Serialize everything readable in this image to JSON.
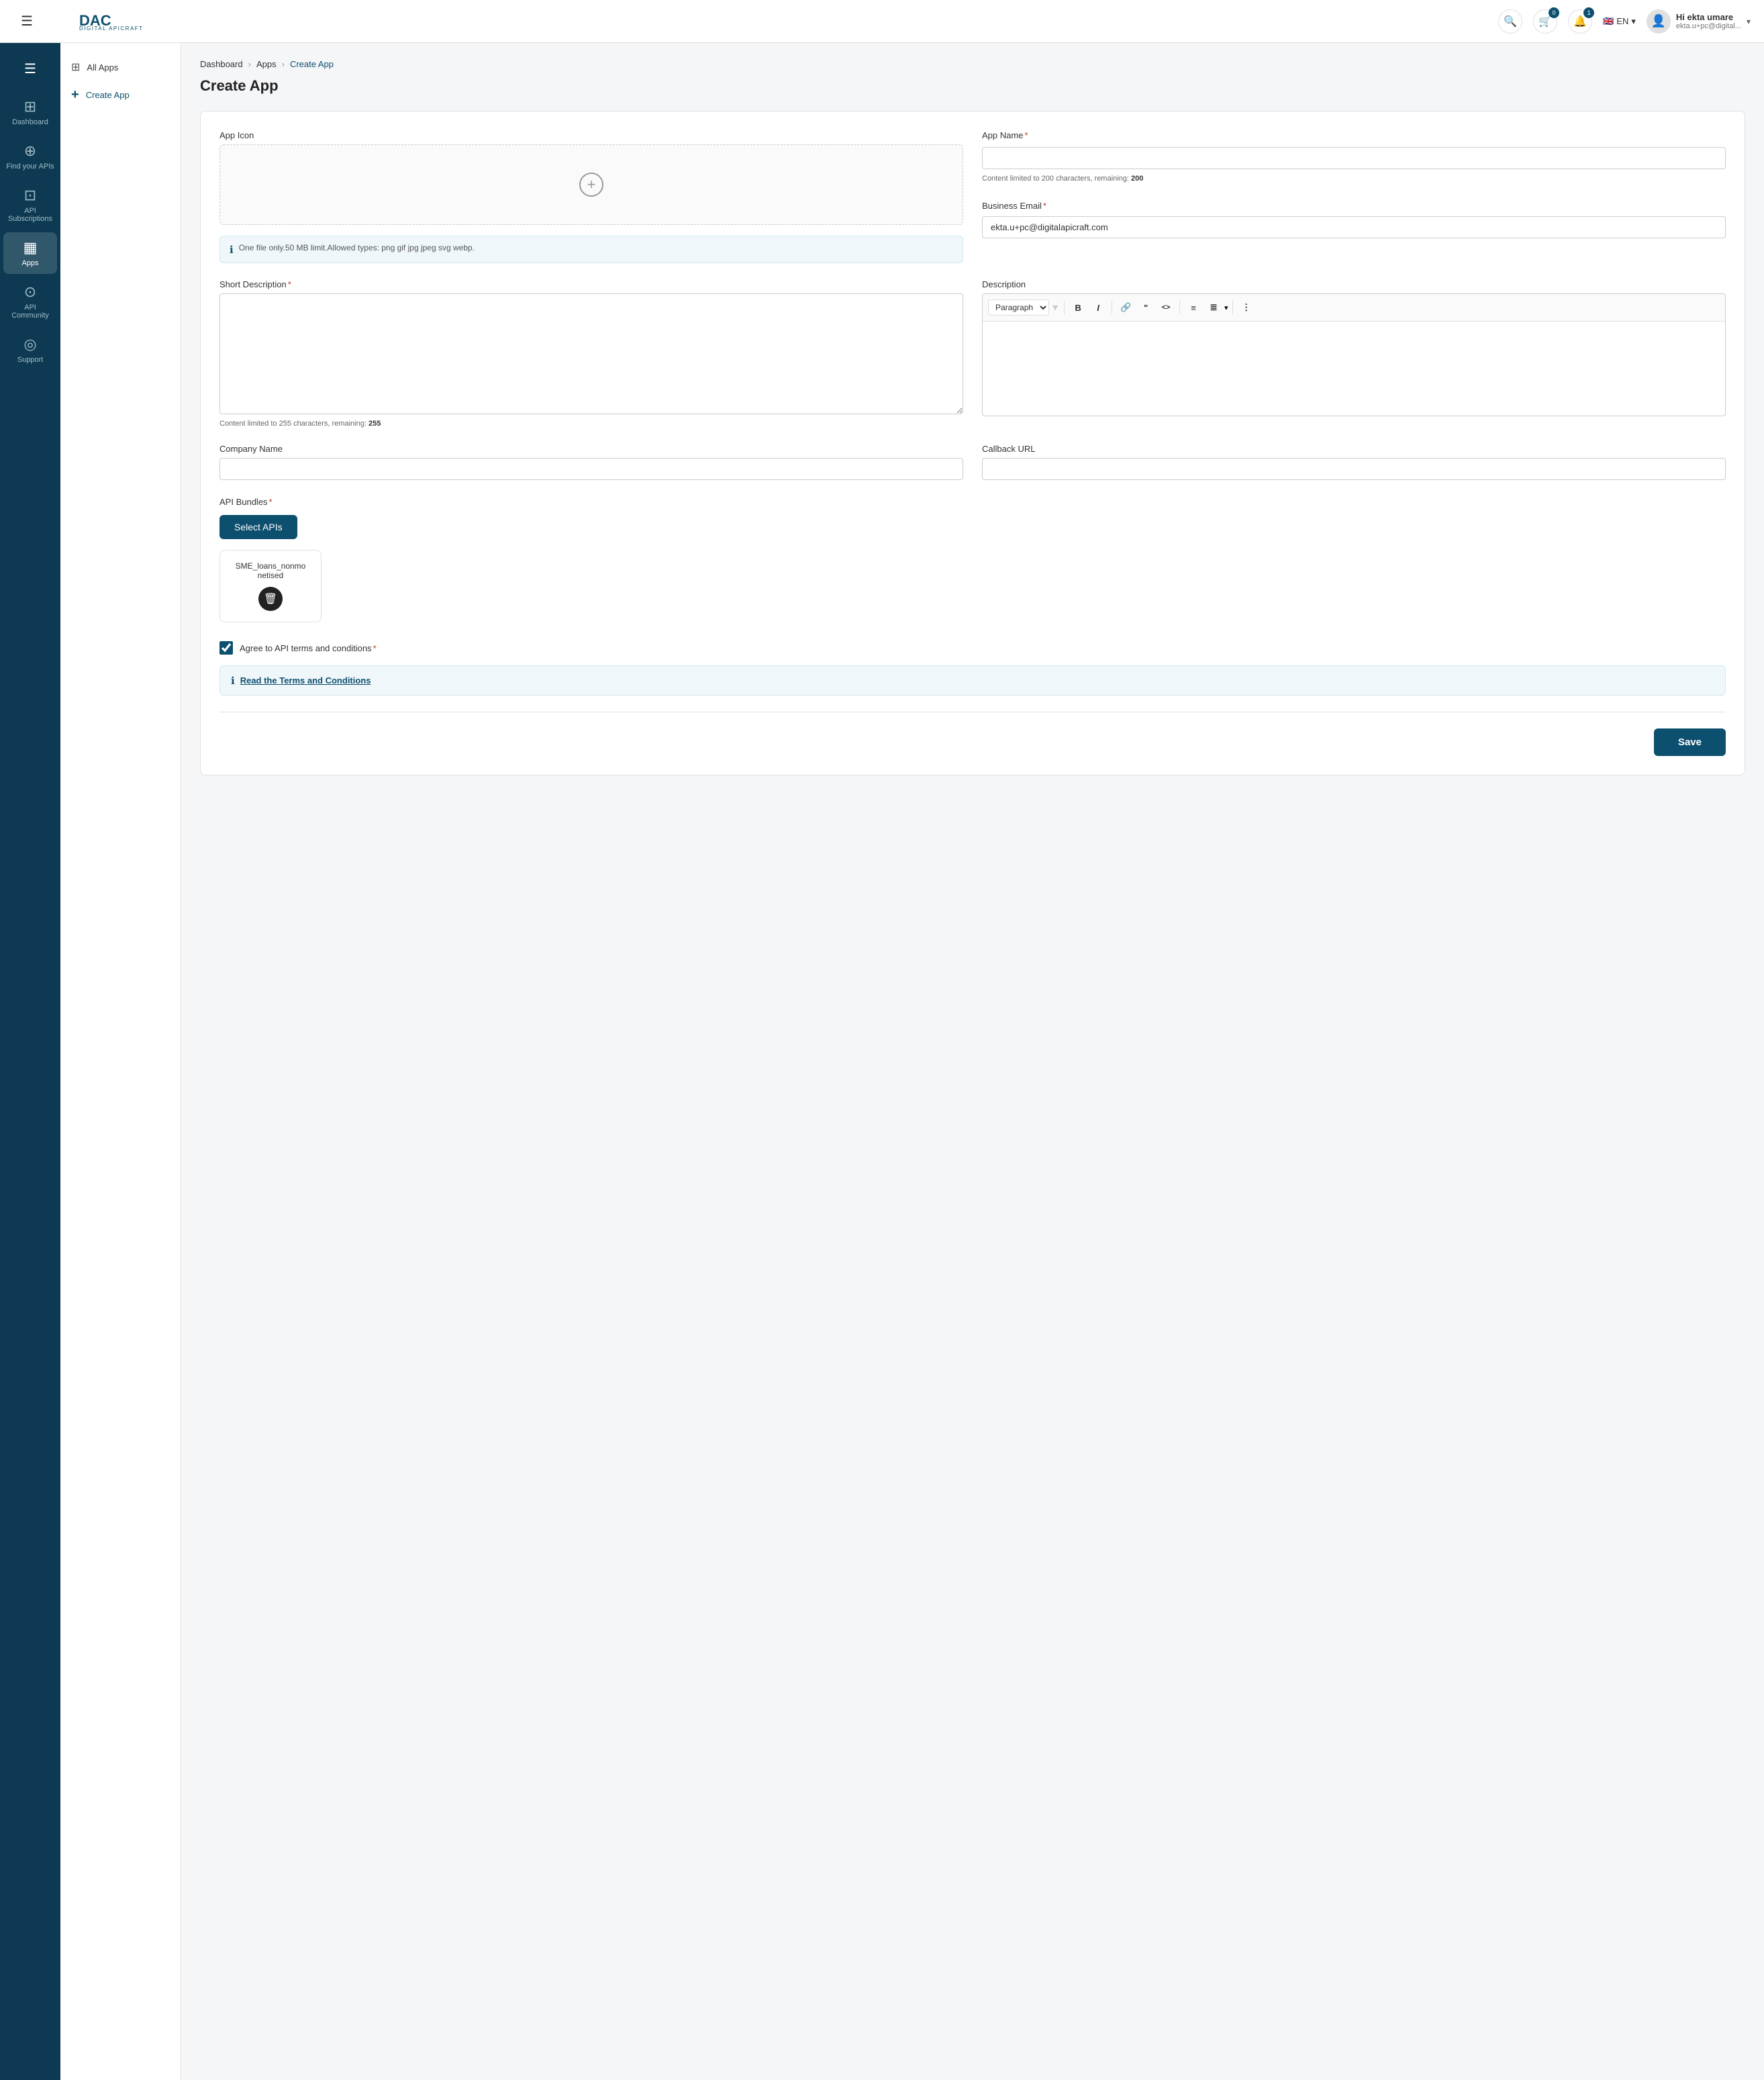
{
  "header": {
    "logo_main": "DAC",
    "logo_sub": "DIGITAL APICRAFT",
    "search_placeholder": "Search",
    "cart_badge": "0",
    "notification_badge": "1",
    "lang": "EN",
    "user_greeting": "Hi ekta umare",
    "user_email": "ekta.u+pc@digital..."
  },
  "sidebar": {
    "items": [
      {
        "label": "Dashboard",
        "icon": "⊞"
      },
      {
        "label": "Find your APIs",
        "icon": "⊕"
      },
      {
        "label": "API Subscriptions",
        "icon": "⊡"
      },
      {
        "label": "Apps",
        "icon": "▦",
        "active": true
      },
      {
        "label": "API Community",
        "icon": "⊙"
      },
      {
        "label": "Support",
        "icon": "◎"
      }
    ]
  },
  "sub_sidebar": {
    "items": [
      {
        "label": "All Apps",
        "icon": "grid"
      },
      {
        "label": "Create App",
        "icon": "plus",
        "type": "create"
      }
    ]
  },
  "breadcrumb": {
    "items": [
      "Dashboard",
      "Apps",
      "Create App"
    ]
  },
  "page": {
    "title": "Create App"
  },
  "form": {
    "app_icon_label": "App Icon",
    "icon_info": "One file only.50 MB limit.Allowed types: png gif jpg jpeg svg webp.",
    "app_name_label": "App Name",
    "app_name_required": true,
    "app_name_value": "",
    "app_name_char_limit": "Content limited to 200 characters, remaining:",
    "app_name_remaining": "200",
    "business_email_label": "Business Email",
    "business_email_required": true,
    "business_email_value": "ekta.u+pc@digitalapicraft.com",
    "short_desc_label": "Short Description",
    "short_desc_required": true,
    "short_desc_value": "",
    "short_desc_char_limit": "Content limited to 255 characters, remaining:",
    "short_desc_remaining": "255",
    "description_label": "Description",
    "description_toolbar": {
      "paragraph_select": "Paragraph",
      "bold": "B",
      "italic": "I",
      "link": "🔗",
      "quote": "❝",
      "code": "<>",
      "list_ul": "≡",
      "list_ol": "≣",
      "more": "⋮"
    },
    "company_name_label": "Company Name",
    "company_name_value": "",
    "callback_url_label": "Callback URL",
    "callback_url_value": "",
    "api_bundles_label": "API Bundles",
    "api_bundles_required": true,
    "select_apis_btn": "Select APIs",
    "api_bundle_name": "SME_loans_nonmo netised",
    "terms_label": "Agree to API terms and conditions",
    "terms_required": true,
    "terms_link": "Read the Terms and Conditions",
    "terms_checked": true,
    "save_btn": "Save"
  }
}
